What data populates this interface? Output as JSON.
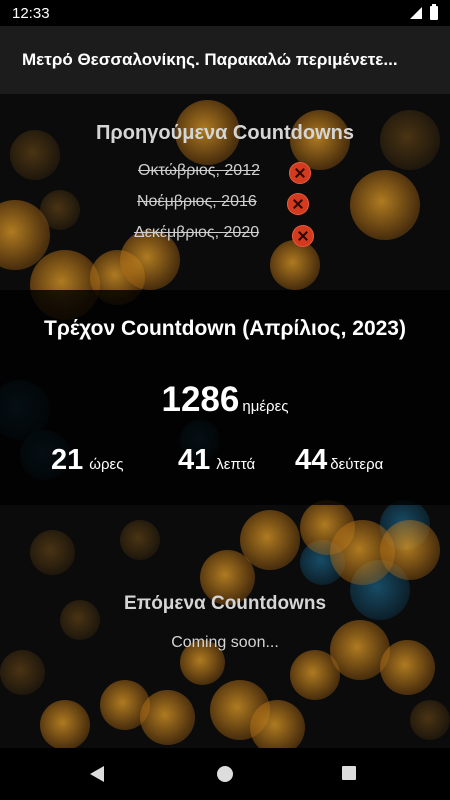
{
  "status_bar": {
    "time": "12:33",
    "icons": [
      "signal-icon",
      "battery-icon"
    ]
  },
  "app_bar": {
    "title": "Μετρό Θεσσαλονίκης. Παρακαλώ περιμένετε..."
  },
  "previous": {
    "title": "Προηγούμενα Countdowns",
    "items": [
      {
        "label": "Οκτώβριος, 2012",
        "remove_icon": "remove-x-icon"
      },
      {
        "label": "Νοέμβριος, 2016",
        "remove_icon": "remove-x-icon"
      },
      {
        "label": "Δεκέμβριος, 2020",
        "remove_icon": "remove-x-icon"
      }
    ]
  },
  "current": {
    "title": "Τρέχον Countdown (Απρίλιος, 2023)",
    "days_value": "1286",
    "days_label": "ημέρες",
    "hours_value": "21",
    "hours_label": "ώρες",
    "minutes_value": "41",
    "minutes_label": "λεπτά",
    "seconds_value": "44",
    "seconds_label": "δεύτερα"
  },
  "next": {
    "title": "Επόμενα Countdowns",
    "subtitle": "Coming soon..."
  },
  "nav_bar": {
    "icons": [
      "back-icon",
      "home-icon",
      "recents-icon"
    ]
  },
  "colors": {
    "remove_red": "#d43a1e",
    "panel_dark": "#1c1c1c",
    "bokeh_orange": "#e6a028",
    "bokeh_blue": "#1e6e96"
  }
}
